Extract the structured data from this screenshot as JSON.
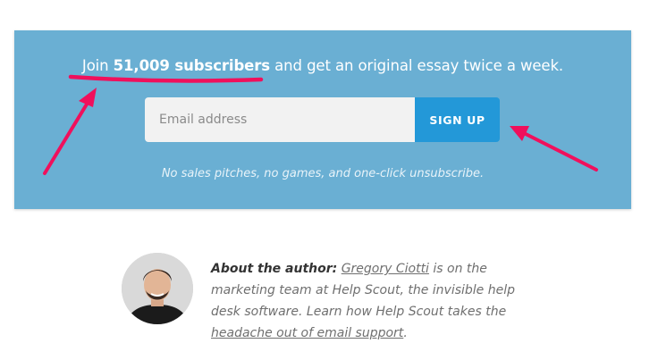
{
  "signup": {
    "headline_prefix": "Join ",
    "headline_highlight": "51,009 subscribers",
    "headline_suffix": " and get an original essay twice a week.",
    "email_placeholder": "Email address",
    "button_label": "SIGN UP",
    "disclaimer": "No sales pitches, no games, and one-click unsubscribe.",
    "background_color": "#6aafd3",
    "button_color": "#2398d8"
  },
  "annotations": {
    "arrow_color": "#f0105c"
  },
  "author": {
    "lead": "About the author:",
    "name": "Gregory Ciotti",
    "text_1": " is on the marketing team at Help Scout, the invisible help desk software. Learn how Help Scout takes the ",
    "link_text": "headache out of email support",
    "text_2": "."
  }
}
